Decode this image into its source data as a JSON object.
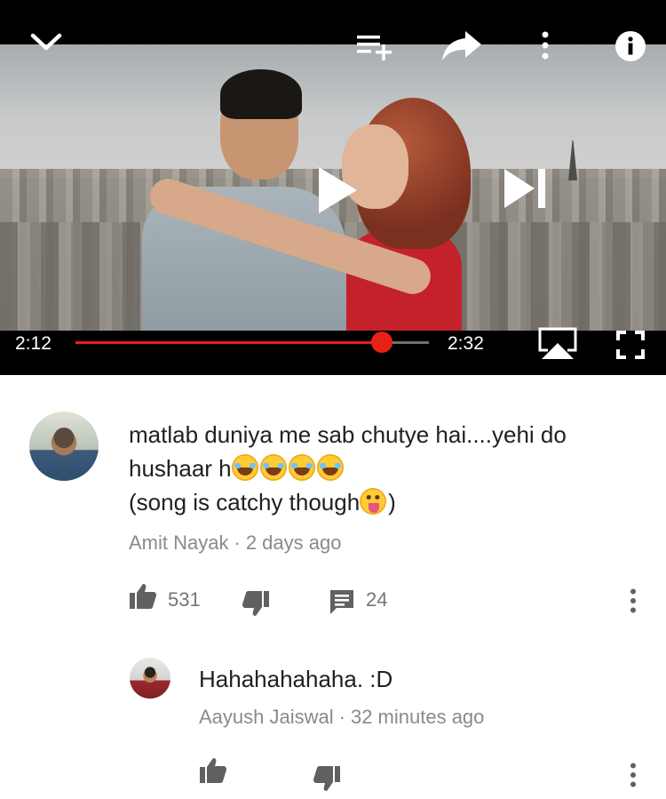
{
  "player": {
    "current_time": "2:12",
    "duration": "2:32",
    "progress_fraction": 0.868,
    "colors": {
      "progress": "#e62117",
      "track": "#6f6f6f"
    },
    "icons": [
      "chevron-down-icon",
      "add-to-playlist-icon",
      "share-icon",
      "more-vert-icon",
      "info-icon",
      "play-icon",
      "skip-next-icon",
      "airplay-icon",
      "fullscreen-icon"
    ]
  },
  "comments": [
    {
      "text_line1": "matlab duniya me sab chutye hai....yehi do",
      "text_line2_prefix": "hushaar h",
      "text_line3_prefix": "(song is catchy though",
      "text_line3_suffix": ")",
      "emoji_line2": [
        "face-with-tears-of-joy",
        "face-with-tears-of-joy",
        "face-with-tears-of-joy",
        "face-with-tears-of-joy"
      ],
      "emoji_line3": "face-with-tongue",
      "author": "Amit Nayak",
      "separator": "·",
      "time": "2 days ago",
      "likes": "531",
      "replies": "24"
    },
    {
      "text": "Hahahahahaha. :D",
      "author": "Aayush Jaiswal",
      "separator": "·",
      "time": "32 minutes ago"
    }
  ]
}
